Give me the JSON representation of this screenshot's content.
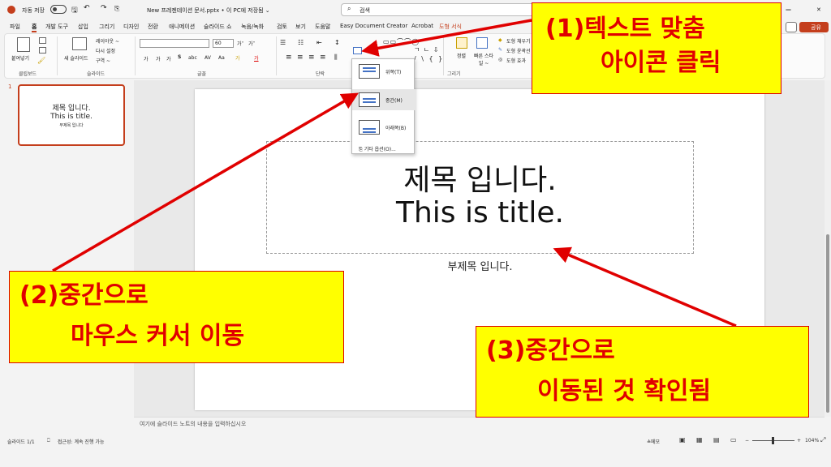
{
  "titlebar": {
    "autosave_label": "자동 저장",
    "toggle_state": "끔",
    "document_title": "New 프레젠테이션 문서.pptx • 이 PC에 저장됨 ⌄",
    "search_placeholder": "검색",
    "window_controls": [
      "—",
      "✕"
    ]
  },
  "tabs": [
    {
      "label": "파일"
    },
    {
      "label": "홈"
    },
    {
      "label": "개발 도구"
    },
    {
      "label": "삽입"
    },
    {
      "label": "그리기"
    },
    {
      "label": "디자인"
    },
    {
      "label": "전환"
    },
    {
      "label": "애니메이션"
    },
    {
      "label": "슬라이드 쇼"
    },
    {
      "label": "녹음/녹화"
    },
    {
      "label": "검토"
    },
    {
      "label": "보기"
    },
    {
      "label": "도움말"
    },
    {
      "label": "Easy Document Creator"
    },
    {
      "label": "Acrobat"
    },
    {
      "label": "도형 서식"
    }
  ],
  "share_label": "공유",
  "ribbon": {
    "paste_label": "붙여넣기",
    "new_slide_label": "새 슬라이드",
    "layout_label": "레이아웃 ~",
    "reset_label": "다시 설정",
    "section_label": "구역 ~",
    "font_size": "60",
    "font_grow": "가˄",
    "font_shrink": "가˅",
    "arrange_label": "정렬",
    "quick_style_label": "빠른 스타일 ~",
    "shape_fill": "도형 채우기",
    "shape_outline": "도형 윤곽선",
    "shape_effects": "도형 효과",
    "groups": [
      "클립보드",
      "슬라이드",
      "글꼴",
      "단락",
      "그리기"
    ],
    "font_buttons": [
      "가",
      "가",
      "가",
      "S",
      "abc",
      "AV",
      "Aa",
      "가",
      "가"
    ]
  },
  "align_menu": {
    "items": [
      {
        "label": "위쪽(T)",
        "hover": false
      },
      {
        "label": "중간(M)",
        "hover": true
      },
      {
        "label": "아래쪽(B)",
        "hover": false
      }
    ],
    "more_options": "기타 옵션(O)..."
  },
  "thumbnail": {
    "number": "1",
    "title1": "제목 입니다.",
    "title2": "This is title.",
    "subtitle": "부제목 입니다"
  },
  "slide": {
    "title_line1": "제목 입니다.",
    "title_line2": "This is title.",
    "subtitle": "부제목 입니다."
  },
  "notes_placeholder": "여기에 슬라이드 노트의 내용을 입력하십시오",
  "status": {
    "slide_count": "슬라이드 1/1",
    "accessibility": "접근성: 계속 진행 가능",
    "notes_label": "≙메모",
    "zoom": "104%"
  },
  "callouts": {
    "c1": [
      "(1)텍스트 맞춤",
      "아이콘 클릭"
    ],
    "c2": [
      "(2)중간으로",
      "마우스 커서 이동"
    ],
    "c3": [
      "(3)중간으로",
      "이동된 것 확인됨"
    ]
  },
  "colors": {
    "accent": "#c43e1c",
    "callout_bg": "#ffff00",
    "callout_text": "#e00000",
    "arrow": "#e00000"
  }
}
